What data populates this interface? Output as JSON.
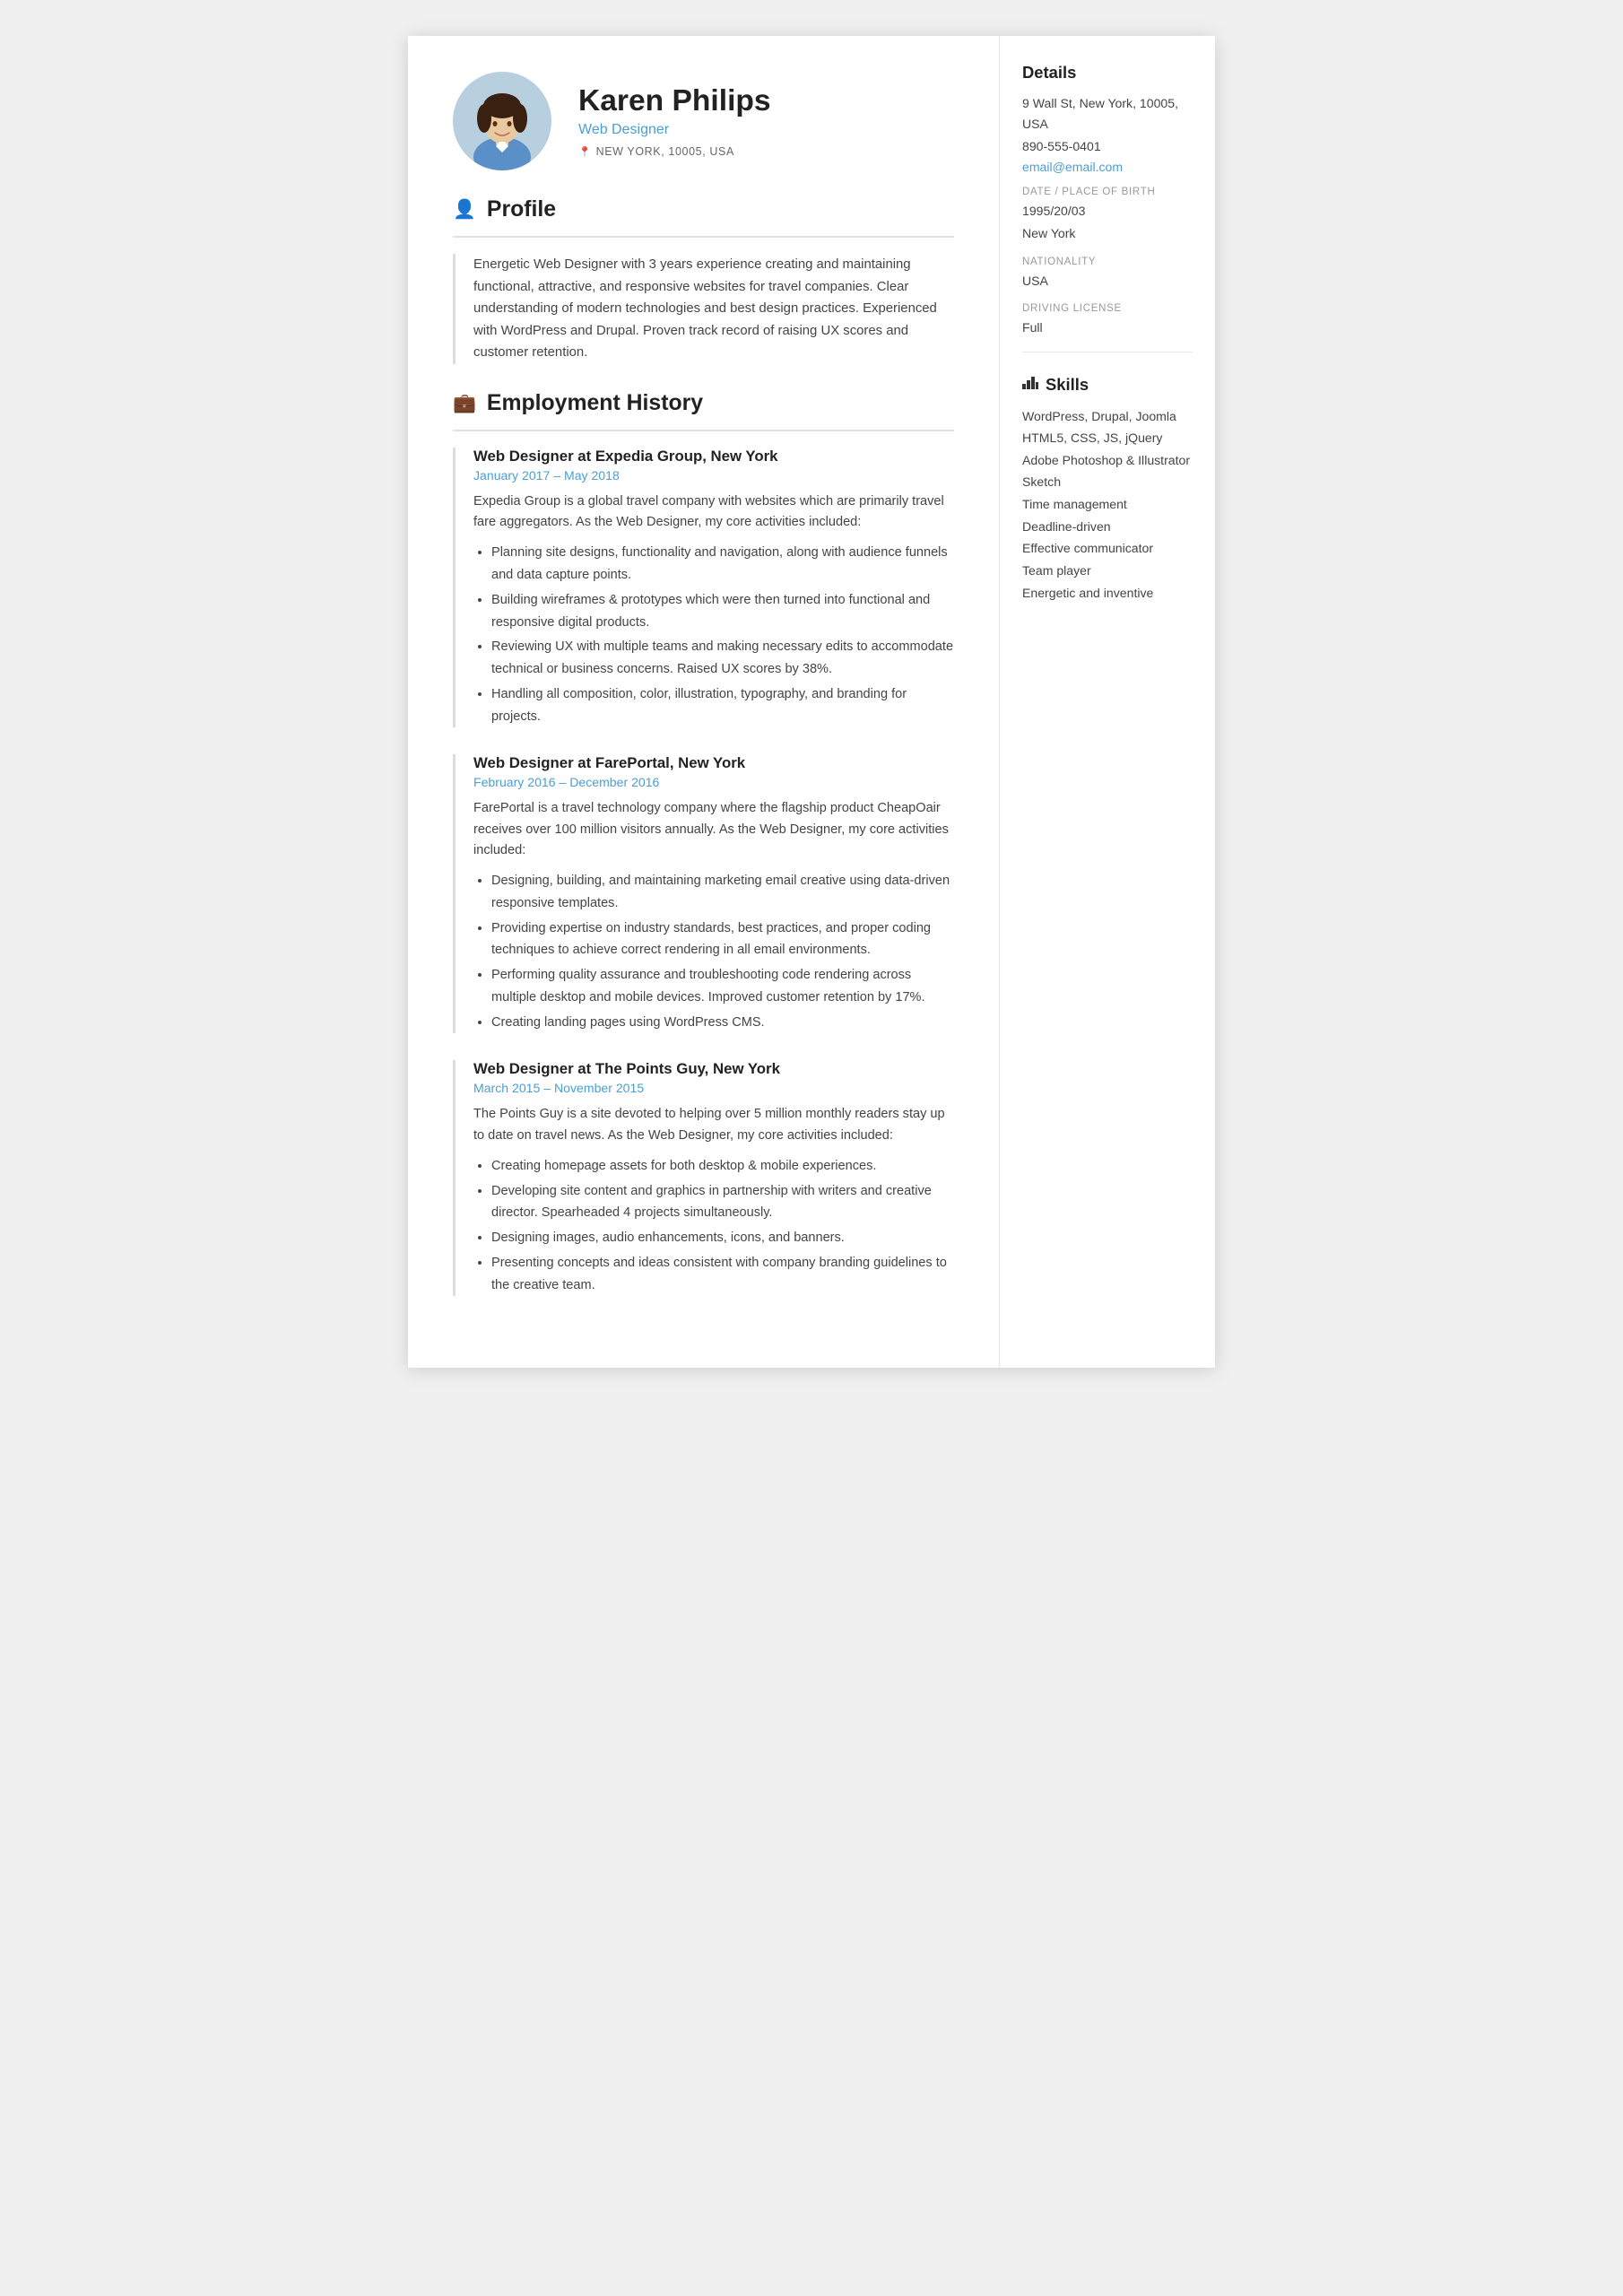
{
  "header": {
    "name": "Karen Philips",
    "job_title": "Web Designer",
    "location": "NEW YORK, 10005, USA"
  },
  "sidebar": {
    "details_title": "Details",
    "address": "9 Wall St, New York, 10005, USA",
    "phone": "890-555-0401",
    "email": "email@email.com",
    "dob_label": "DATE / PLACE OF BIRTH",
    "dob": "1995/20/03",
    "dob_place": "New York",
    "nationality_label": "NATIONALITY",
    "nationality": "USA",
    "driving_label": "DRIVING LICENSE",
    "driving": "Full",
    "skills_title": "Skills",
    "skills": [
      "WordPress, Drupal, Joomla",
      "HTML5, CSS, JS, jQuery",
      "Adobe Photoshop & Illustrator",
      "Sketch",
      "Time management",
      "Deadline-driven",
      "Effective communicator",
      "Team player",
      "Energetic and inventive"
    ]
  },
  "profile": {
    "section_title": "Profile",
    "text": "Energetic Web Designer with 3 years experience creating and maintaining functional, attractive, and responsive websites for travel companies. Clear understanding of modern technologies and best design practices. Experienced with WordPress and Drupal. Proven track record of raising UX scores and customer retention."
  },
  "employment": {
    "section_title": "Employment History",
    "jobs": [
      {
        "title": "Web Designer at Expedia Group, New York",
        "dates": "January 2017  –  May 2018",
        "description": "Expedia Group is a global travel company with websites which are primarily travel fare aggregators. As the Web Designer, my core activities included:",
        "bullets": [
          "Planning site designs, functionality and navigation, along with audience funnels and data capture points.",
          "Building wireframes & prototypes which were then turned into functional and responsive digital products.",
          "Reviewing UX with multiple teams and making necessary edits to accommodate technical or business concerns. Raised UX scores by 38%.",
          "Handling all composition, color, illustration, typography, and branding for projects."
        ]
      },
      {
        "title": "Web Designer at FarePortal, New York",
        "dates": "February 2016  –  December 2016",
        "description": "FarePortal is a travel technology company where the flagship product CheapOair receives over 100 million visitors annually. As the Web Designer, my core activities included:",
        "bullets": [
          "Designing, building, and maintaining marketing email creative using data-driven responsive templates.",
          "Providing expertise on industry standards, best practices, and proper coding techniques to achieve correct rendering in all email environments.",
          "Performing quality assurance and troubleshooting code rendering across multiple desktop and mobile devices. Improved customer retention by 17%.",
          "Creating landing pages using WordPress CMS."
        ]
      },
      {
        "title": "Web Designer at The Points Guy, New York",
        "dates": "March 2015  –  November 2015",
        "description": "The Points Guy is a site devoted to helping over 5 million monthly readers stay up to date on travel news. As the Web Designer, my core activities included:",
        "bullets": [
          "Creating homepage assets for both desktop & mobile experiences.",
          "Developing site content and graphics in partnership with writers and creative director. Spearheaded 4 projects simultaneously.",
          "Designing images, audio enhancements, icons, and banners.",
          "Presenting concepts and ideas consistent with company branding guidelines to the creative team."
        ]
      }
    ]
  }
}
